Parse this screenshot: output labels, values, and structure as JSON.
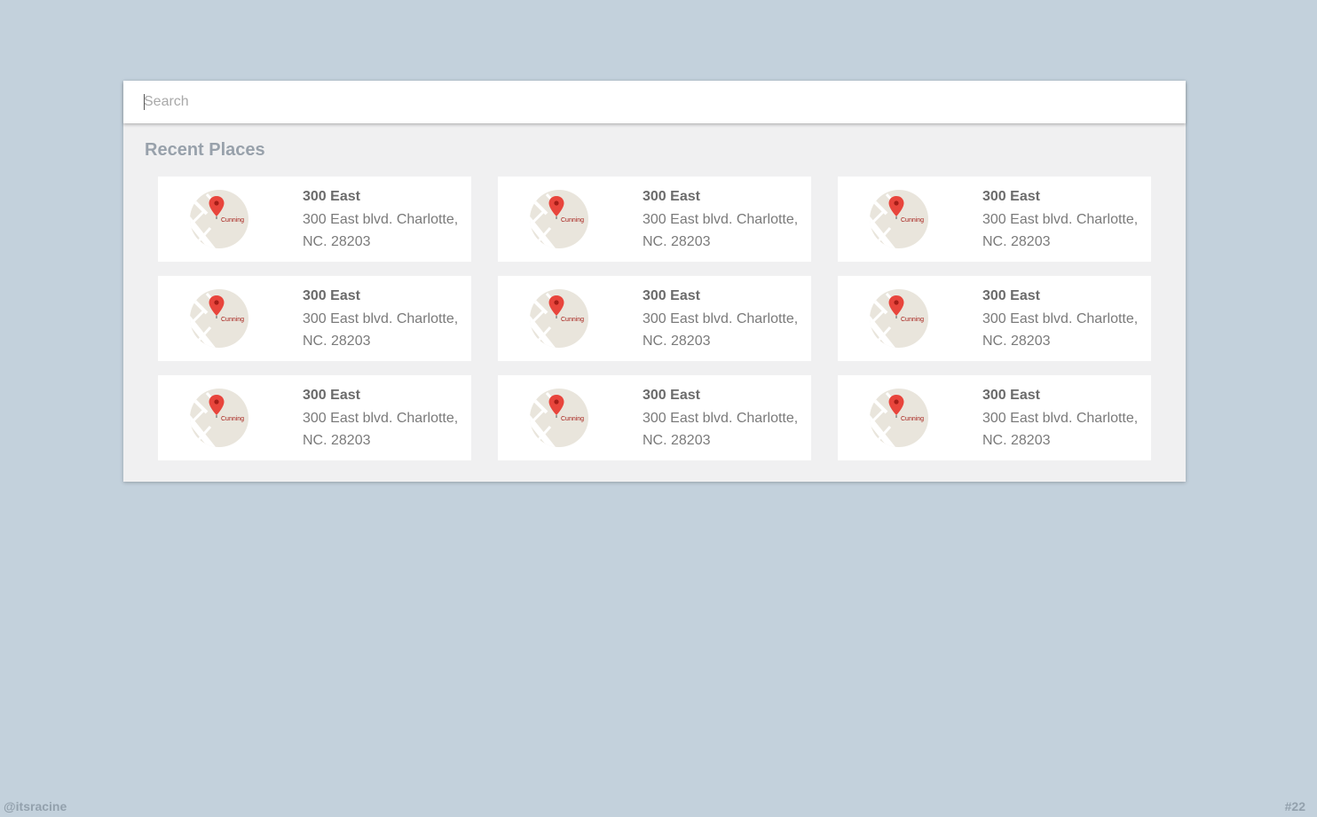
{
  "search": {
    "placeholder": "Search",
    "value": ""
  },
  "recent": {
    "title": "Recent Places",
    "places": [
      {
        "name": "300 East",
        "address": "300 East blvd. Charlotte, NC. 28203",
        "map_label": "Cunning"
      },
      {
        "name": "300 East",
        "address": "300 East blvd. Charlotte, NC. 28203",
        "map_label": "Cunning"
      },
      {
        "name": "300 East",
        "address": "300 East blvd. Charlotte, NC. 28203",
        "map_label": "Cunning"
      },
      {
        "name": "300 East",
        "address": "300 East blvd. Charlotte, NC. 28203",
        "map_label": "Cunning"
      },
      {
        "name": "300 East",
        "address": "300 East blvd. Charlotte, NC. 28203",
        "map_label": "Cunning"
      },
      {
        "name": "300 East",
        "address": "300 East blvd. Charlotte, NC. 28203",
        "map_label": "Cunning"
      },
      {
        "name": "300 East",
        "address": "300 East blvd. Charlotte, NC. 28203",
        "map_label": "Cunning"
      },
      {
        "name": "300 East",
        "address": "300 East blvd. Charlotte, NC. 28203",
        "map_label": "Cunning"
      },
      {
        "name": "300 East",
        "address": "300 East blvd. Charlotte, NC. 28203",
        "map_label": "Cunning"
      }
    ]
  },
  "footer": {
    "author": "@itsracine",
    "number": "#22"
  },
  "colors": {
    "background": "#c3d1dc",
    "panel": "#f0f0f1",
    "card": "#ffffff",
    "pin": "#e8453c",
    "map_land": "#e9e5dc"
  },
  "icons": {
    "thumbnail": "map-pin-thumbnail-icon"
  }
}
